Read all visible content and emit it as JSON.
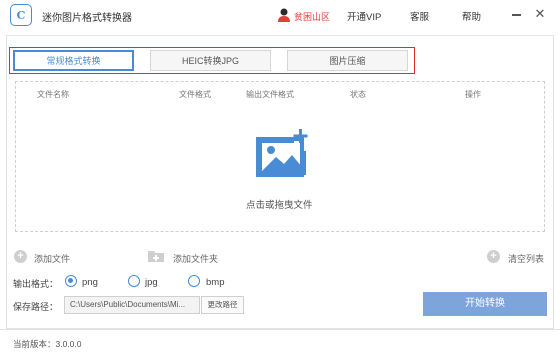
{
  "app": {
    "title": "迷你图片格式转换器",
    "logo_text": "C"
  },
  "header": {
    "username": "贫困山区",
    "menu_vip": "开通VIP",
    "menu_service": "客服",
    "menu_help": "帮助"
  },
  "tabs": [
    {
      "label": "常规格式转换",
      "active": true
    },
    {
      "label": "HEIC转换JPG",
      "active": false
    },
    {
      "label": "图片压缩",
      "active": false
    }
  ],
  "table": {
    "columns": [
      "文件名称",
      "文件格式",
      "输出文件格式",
      "状态",
      "操作"
    ]
  },
  "dropzone": {
    "text": "点击或拖曳文件"
  },
  "actions": {
    "add_file": "添加文件",
    "add_folder": "添加文件夹",
    "clear_list": "清空列表"
  },
  "output": {
    "label": "输出格式：",
    "options": [
      "png",
      "jpg",
      "bmp"
    ],
    "selected": "png"
  },
  "save": {
    "label": "保存路径：",
    "path": "C:\\Users\\Public\\Documents\\Mi...",
    "change_button": "更改路径"
  },
  "start_button": "开始转换",
  "footer": {
    "version": "当前版本：3.0.0.0"
  },
  "colors": {
    "accent": "#4a8bd6",
    "highlight_frame": "#e32b32",
    "start_button": "#7ea4dc"
  }
}
